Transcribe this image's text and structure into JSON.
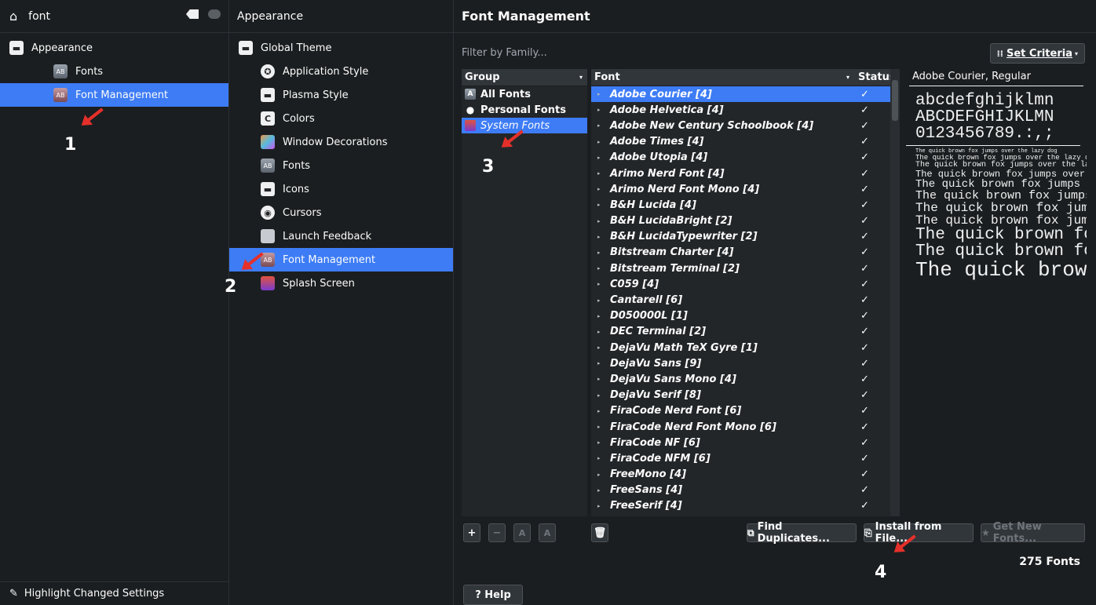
{
  "sidebar": {
    "search_value": "font",
    "items": [
      {
        "label": "Appearance",
        "icon": "theme-icon"
      },
      {
        "label": "Fonts",
        "icon": "fonts-icon"
      },
      {
        "label": "Font Management",
        "icon": "font-management-icon"
      }
    ],
    "highlight_label": "Highlight Changed Settings"
  },
  "category": {
    "title": "Appearance",
    "items": [
      {
        "label": "Global Theme"
      },
      {
        "label": "Application Style"
      },
      {
        "label": "Plasma Style"
      },
      {
        "label": "Colors"
      },
      {
        "label": "Window Decorations"
      },
      {
        "label": "Fonts"
      },
      {
        "label": "Icons"
      },
      {
        "label": "Cursors"
      },
      {
        "label": "Launch Feedback"
      },
      {
        "label": "Font Management"
      },
      {
        "label": "Splash Screen"
      }
    ]
  },
  "main": {
    "title": "Font Management",
    "filter_placeholder": "Filter by Family...",
    "set_criteria_label": "Set Criteria",
    "group_header": "Group",
    "groups": [
      {
        "label": "All Fonts"
      },
      {
        "label": "Personal Fonts"
      },
      {
        "label": "System Fonts"
      }
    ],
    "font_header": "Font",
    "status_header": "Status",
    "fonts": [
      "Adobe Courier [4]",
      "Adobe Helvetica [4]",
      "Adobe New Century Schoolbook [4]",
      "Adobe Times [4]",
      "Adobe Utopia [4]",
      "Arimo Nerd Font [4]",
      "Arimo Nerd Font Mono [4]",
      "B&H Lucida [4]",
      "B&H LucidaBright [2]",
      "B&H LucidaTypewriter [2]",
      "Bitstream Charter [4]",
      "Bitstream Terminal [2]",
      "C059 [4]",
      "Cantarell [6]",
      "D050000L [1]",
      "DEC Terminal [2]",
      "DejaVu Math TeX Gyre [1]",
      "DejaVu Sans [9]",
      "DejaVu Sans Mono [4]",
      "DejaVu Serif [8]",
      "FiraCode Nerd Font [6]",
      "FiraCode Nerd Font Mono [6]",
      "FiraCode NF [6]",
      "FiraCode NFM [6]",
      "FreeMono [4]",
      "FreeSans [4]",
      "FreeSerif [4]"
    ],
    "status_check": "✓",
    "preview": {
      "title": "Adobe Courier, Regular",
      "alphabet_lower": "abcdefghijklmn",
      "alphabet_upper": "ABCDEFGHIJKLMN",
      "digits": "0123456789.:,;",
      "sample": "The quick brown fox jumps over the lazy dog"
    },
    "buttons": {
      "add": "+",
      "remove": "−",
      "enable": "A",
      "disable": "A",
      "delete_icon": "trash-icon",
      "find_duplicates": "Find Duplicates...",
      "install_from_file": "Install from File...",
      "get_new_fonts": "Get New Fonts..."
    },
    "font_count": "275 Fonts",
    "help_label": "? Help"
  },
  "annotations": [
    "1",
    "2",
    "3",
    "4"
  ],
  "colors": {
    "accent": "#3d7cf5",
    "background": "#1b1e20",
    "panel": "#232629",
    "arrow": "#e5302a"
  }
}
